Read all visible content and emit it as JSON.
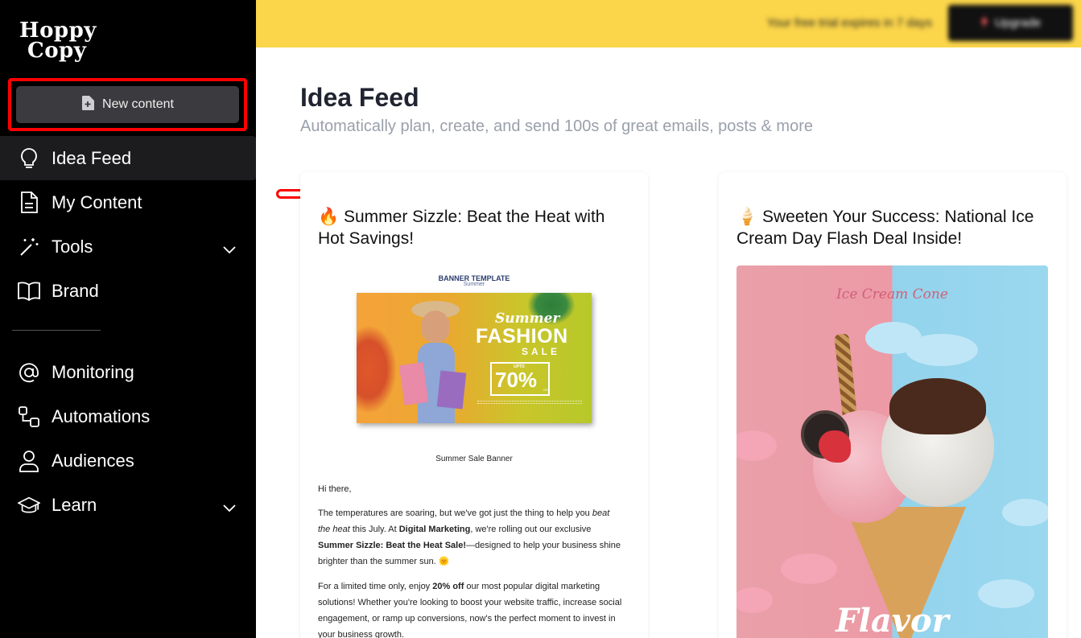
{
  "sidebar": {
    "logo_line1": "Hoppy",
    "logo_line2": "Copy",
    "new_content": "New content",
    "items_top": [
      {
        "label": "Idea Feed",
        "icon": "lightbulb-icon",
        "active": true
      },
      {
        "label": "My Content",
        "icon": "document-icon"
      },
      {
        "label": "Tools",
        "icon": "magic-wand-icon",
        "has_chevron": true
      },
      {
        "label": "Brand",
        "icon": "book-icon"
      }
    ],
    "items_bottom": [
      {
        "label": "Monitoring",
        "icon": "at-sign-icon"
      },
      {
        "label": "Automations",
        "icon": "automation-icon"
      },
      {
        "label": "Audiences",
        "icon": "person-icon"
      },
      {
        "label": "Learn",
        "icon": "graduation-cap-icon",
        "has_chevron": true
      }
    ]
  },
  "topbar": {
    "trial_text": "Your free trial expires in 7 days",
    "upgrade_label": "Upgrade",
    "color": "#fbd54a"
  },
  "main": {
    "title": "Idea Feed",
    "subtitle": "Automatically plan, create, and send 100s of great emails, posts & more"
  },
  "cards": [
    {
      "emoji": "🔥",
      "title": "Summer Sizzle: Beat the Heat with Hot Savings!",
      "image": {
        "template_label": "BANNER TEMPLATE",
        "template_sub": "Summer",
        "summer": "Summer",
        "fashion": "FASHION",
        "sale": "SALE",
        "upto": "UPTO",
        "percent": "70%",
        "off": "OFF"
      },
      "caption": "Summer Sale Banner",
      "greeting": "Hi there,",
      "para1": {
        "t1": "The temperatures are soaring, but we've got just the thing to help you ",
        "i1": "beat the heat",
        "t2": " this July. At ",
        "b1": "Digital Marketing",
        "t3": ", we're rolling out our exclusive ",
        "b2": "Summer Sizzle: Beat the Heat Sale!",
        "t4": "—designed to help your business shine brighter than the summer sun. 🌞"
      },
      "para2": {
        "t1": "For a limited time only, enjoy ",
        "b1": "20% off",
        "t2": " our most popular digital marketing solutions! Whether you're looking to boost your website traffic, increase social engagement, or ramp up conversions, now's the perfect moment to invest in your business growth."
      }
    },
    {
      "emoji": "🍦",
      "title": "Sweeten Your Success: National Ice Cream Day Flash Deal Inside!",
      "image": {
        "title": "Ice Cream Cone",
        "flavor": "Flavor"
      }
    }
  ]
}
